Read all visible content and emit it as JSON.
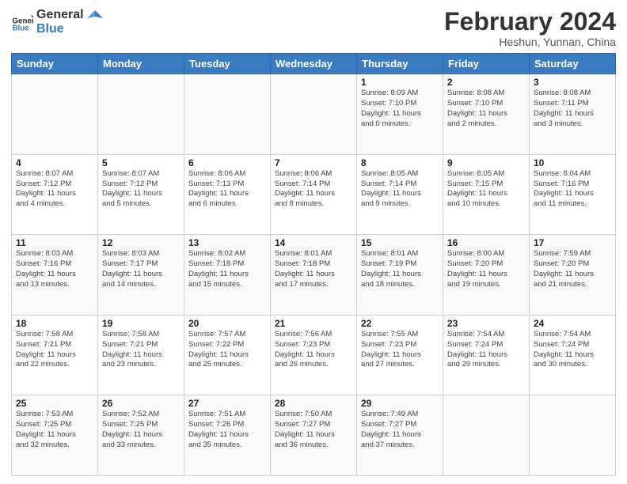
{
  "logo": {
    "general": "General",
    "blue": "Blue"
  },
  "title": "February 2024",
  "subtitle": "Heshun, Yunnan, China",
  "headers": [
    "Sunday",
    "Monday",
    "Tuesday",
    "Wednesday",
    "Thursday",
    "Friday",
    "Saturday"
  ],
  "weeks": [
    [
      {
        "day": "",
        "info": ""
      },
      {
        "day": "",
        "info": ""
      },
      {
        "day": "",
        "info": ""
      },
      {
        "day": "",
        "info": ""
      },
      {
        "day": "1",
        "info": "Sunrise: 8:09 AM\nSunset: 7:10 PM\nDaylight: 11 hours\nand 0 minutes."
      },
      {
        "day": "2",
        "info": "Sunrise: 8:08 AM\nSunset: 7:10 PM\nDaylight: 11 hours\nand 2 minutes."
      },
      {
        "day": "3",
        "info": "Sunrise: 8:08 AM\nSunset: 7:11 PM\nDaylight: 11 hours\nand 3 minutes."
      }
    ],
    [
      {
        "day": "4",
        "info": "Sunrise: 8:07 AM\nSunset: 7:12 PM\nDaylight: 11 hours\nand 4 minutes."
      },
      {
        "day": "5",
        "info": "Sunrise: 8:07 AM\nSunset: 7:12 PM\nDaylight: 11 hours\nand 5 minutes."
      },
      {
        "day": "6",
        "info": "Sunrise: 8:06 AM\nSunset: 7:13 PM\nDaylight: 11 hours\nand 6 minutes."
      },
      {
        "day": "7",
        "info": "Sunrise: 8:06 AM\nSunset: 7:14 PM\nDaylight: 11 hours\nand 8 minutes."
      },
      {
        "day": "8",
        "info": "Sunrise: 8:05 AM\nSunset: 7:14 PM\nDaylight: 11 hours\nand 9 minutes."
      },
      {
        "day": "9",
        "info": "Sunrise: 8:05 AM\nSunset: 7:15 PM\nDaylight: 11 hours\nand 10 minutes."
      },
      {
        "day": "10",
        "info": "Sunrise: 8:04 AM\nSunset: 7:16 PM\nDaylight: 11 hours\nand 11 minutes."
      }
    ],
    [
      {
        "day": "11",
        "info": "Sunrise: 8:03 AM\nSunset: 7:16 PM\nDaylight: 11 hours\nand 13 minutes."
      },
      {
        "day": "12",
        "info": "Sunrise: 8:03 AM\nSunset: 7:17 PM\nDaylight: 11 hours\nand 14 minutes."
      },
      {
        "day": "13",
        "info": "Sunrise: 8:02 AM\nSunset: 7:18 PM\nDaylight: 11 hours\nand 15 minutes."
      },
      {
        "day": "14",
        "info": "Sunrise: 8:01 AM\nSunset: 7:18 PM\nDaylight: 11 hours\nand 17 minutes."
      },
      {
        "day": "15",
        "info": "Sunrise: 8:01 AM\nSunset: 7:19 PM\nDaylight: 11 hours\nand 18 minutes."
      },
      {
        "day": "16",
        "info": "Sunrise: 8:00 AM\nSunset: 7:20 PM\nDaylight: 11 hours\nand 19 minutes."
      },
      {
        "day": "17",
        "info": "Sunrise: 7:59 AM\nSunset: 7:20 PM\nDaylight: 11 hours\nand 21 minutes."
      }
    ],
    [
      {
        "day": "18",
        "info": "Sunrise: 7:58 AM\nSunset: 7:21 PM\nDaylight: 11 hours\nand 22 minutes."
      },
      {
        "day": "19",
        "info": "Sunrise: 7:58 AM\nSunset: 7:21 PM\nDaylight: 11 hours\nand 23 minutes."
      },
      {
        "day": "20",
        "info": "Sunrise: 7:57 AM\nSunset: 7:22 PM\nDaylight: 11 hours\nand 25 minutes."
      },
      {
        "day": "21",
        "info": "Sunrise: 7:56 AM\nSunset: 7:23 PM\nDaylight: 11 hours\nand 26 minutes."
      },
      {
        "day": "22",
        "info": "Sunrise: 7:55 AM\nSunset: 7:23 PM\nDaylight: 11 hours\nand 27 minutes."
      },
      {
        "day": "23",
        "info": "Sunrise: 7:54 AM\nSunset: 7:24 PM\nDaylight: 11 hours\nand 29 minutes."
      },
      {
        "day": "24",
        "info": "Sunrise: 7:54 AM\nSunset: 7:24 PM\nDaylight: 11 hours\nand 30 minutes."
      }
    ],
    [
      {
        "day": "25",
        "info": "Sunrise: 7:53 AM\nSunset: 7:25 PM\nDaylight: 11 hours\nand 32 minutes."
      },
      {
        "day": "26",
        "info": "Sunrise: 7:52 AM\nSunset: 7:25 PM\nDaylight: 11 hours\nand 33 minutes."
      },
      {
        "day": "27",
        "info": "Sunrise: 7:51 AM\nSunset: 7:26 PM\nDaylight: 11 hours\nand 35 minutes."
      },
      {
        "day": "28",
        "info": "Sunrise: 7:50 AM\nSunset: 7:27 PM\nDaylight: 11 hours\nand 36 minutes."
      },
      {
        "day": "29",
        "info": "Sunrise: 7:49 AM\nSunset: 7:27 PM\nDaylight: 11 hours\nand 37 minutes."
      },
      {
        "day": "",
        "info": ""
      },
      {
        "day": "",
        "info": ""
      }
    ]
  ]
}
